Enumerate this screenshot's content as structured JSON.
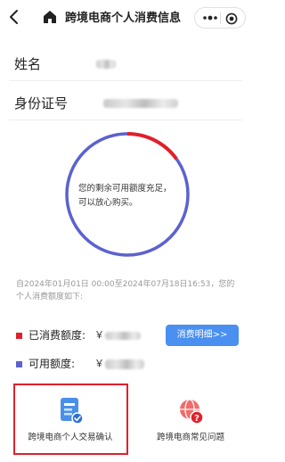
{
  "header": {
    "back_icon": "back-arrow-icon",
    "home_icon": "home-icon",
    "title": "跨境电商个人消费信息",
    "more_icon": "more-icon",
    "close_icon": "mini-close-icon"
  },
  "profile": {
    "name_label": "姓名",
    "id_label": "身份证号"
  },
  "gauge": {
    "line1": "您的剩余可用额度充足，",
    "line2": "可以放心购买。",
    "consumed_fraction": 0.15,
    "consumed_color": "#e0202a",
    "available_color": "#5b62cf"
  },
  "note": "自2024年01月01日 00:00至2024年07月18日16:53，您的个人消费额度如下:",
  "summary": {
    "consumed_label": "已消费额度:",
    "available_label": "可用额度:",
    "currency": "￥",
    "detail_button": "消费明细>>"
  },
  "cards": [
    {
      "label": "跨境电商个人交易确认",
      "icon": "transaction-confirm-icon"
    },
    {
      "label": "跨境电商常见问题",
      "icon": "faq-icon"
    }
  ]
}
